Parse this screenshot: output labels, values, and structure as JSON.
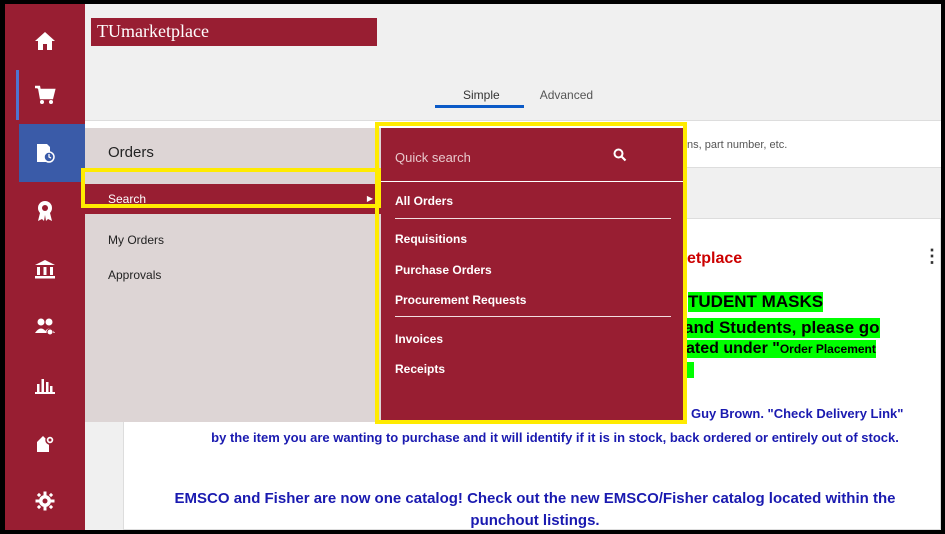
{
  "app": {
    "brand": "TUmarketplace"
  },
  "rail": {
    "items": [
      {
        "name": "home",
        "icon": "home-icon",
        "glyph": "⌂"
      },
      {
        "name": "shop",
        "icon": "cart-icon",
        "glyph": "🛒"
      },
      {
        "name": "orders",
        "icon": "orders-clock-icon",
        "glyph": "▙"
      },
      {
        "name": "contracts",
        "icon": "ribbon-badge-icon",
        "glyph": "✪"
      },
      {
        "name": "accounts",
        "icon": "bank-icon",
        "glyph": "⌂"
      },
      {
        "name": "people",
        "icon": "people-icon",
        "glyph": "⚇"
      },
      {
        "name": "reports",
        "icon": "bar-chart-icon",
        "glyph": "▟"
      },
      {
        "name": "admin",
        "icon": "admin-icon",
        "glyph": "⛭"
      },
      {
        "name": "settings",
        "icon": "gear-icon",
        "glyph": "⚙"
      }
    ]
  },
  "search_tabs": [
    {
      "label": "Simple"
    },
    {
      "label": "Advanced"
    }
  ],
  "search": {
    "placeholder_tail": "ns, part number, etc."
  },
  "orders_menu": {
    "title": "Orders",
    "items": [
      {
        "label": "Search"
      },
      {
        "label": "My Orders"
      },
      {
        "label": "Approvals"
      }
    ]
  },
  "search_menu": {
    "quick_search": "Quick search",
    "items": [
      {
        "label": "All Orders"
      },
      {
        "label": "Requisitions"
      },
      {
        "label": "Purchase Orders"
      },
      {
        "label": "Procurement Requests"
      },
      {
        "label": "Invoices"
      },
      {
        "label": "Receipts"
      }
    ]
  },
  "announcement": {
    "title_fragment": "etplace",
    "masks_line": "TUDENT MASKS",
    "students_line": " and Students, please go",
    "located_line": "ated under ",
    "located_quote": "\"",
    "located_small": "Order Placement",
    "delivery_fragment": "Guy Brown.  \"Check Delivery Link\"",
    "delivery_rest": "by the item you are wanting to purchase and it will identify if it is in stock, back ordered or entirely out of stock.",
    "emsco": "EMSCO and Fisher are now one catalog!  Check out the new EMSCO/Fisher catalog located within the punchout listings."
  },
  "colors": {
    "brand": "#981e32",
    "highlight": "#ffeb00",
    "green": "#00ff00",
    "link_blue": "#1a1ab0"
  }
}
